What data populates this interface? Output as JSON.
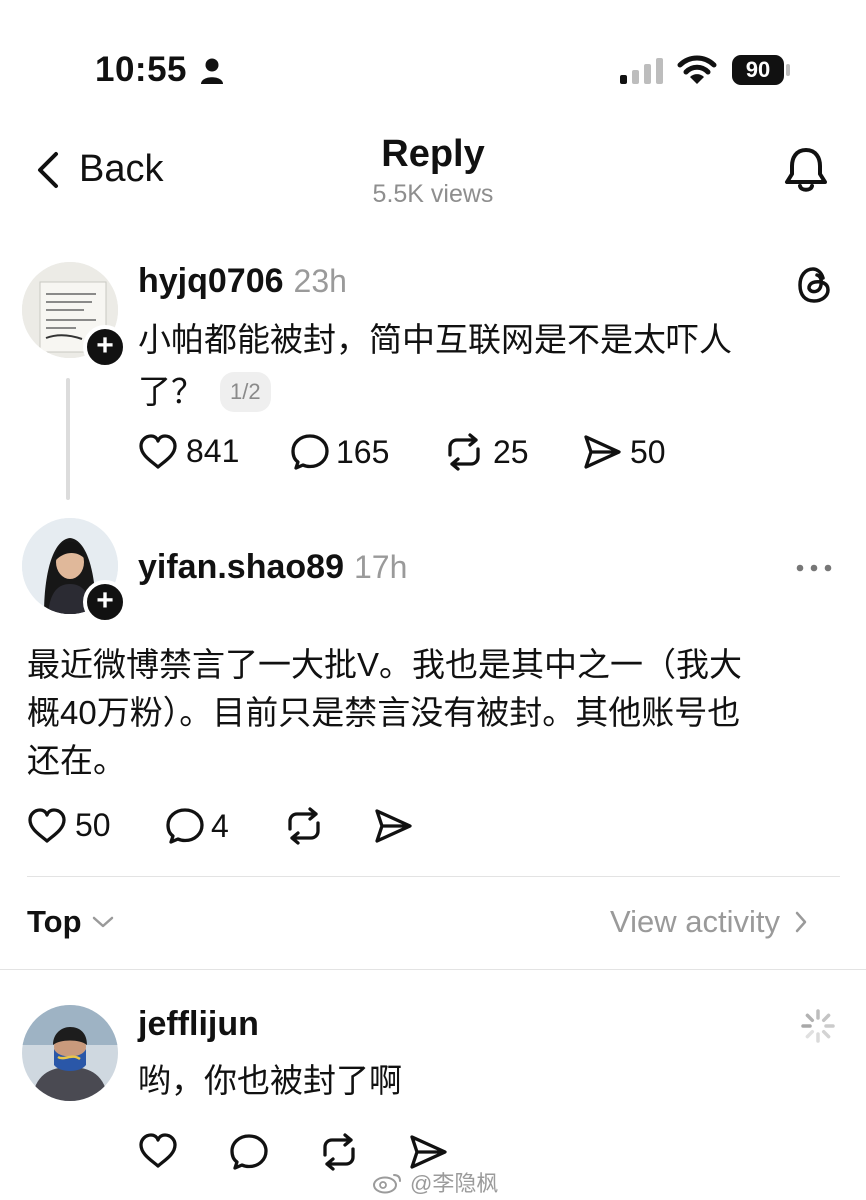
{
  "status_bar": {
    "time": "10:55",
    "battery": "90"
  },
  "header": {
    "back_label": "Back",
    "title": "Reply",
    "views": "5.5K views"
  },
  "posts": [
    {
      "username": "hyjq0706",
      "time_ago": "23h",
      "text_line1": "小帕都能被封，简中互联网是不是太吓人",
      "text_line2": "了？",
      "page_badge": "1/2",
      "likes": "841",
      "comments": "165",
      "reposts": "25",
      "shares": "50"
    },
    {
      "username": "yifan.shao89",
      "time_ago": "17h",
      "text_line1": "最近微博禁言了一大批V。我也是其中之一（我大",
      "text_line2": "概40万粉）。目前只是禁言没有被封。其他账号也",
      "text_line3": "还在。",
      "likes": "50",
      "comments": "4"
    }
  ],
  "sort": {
    "label": "Top",
    "view_activity": "View activity"
  },
  "replies": [
    {
      "username": "jefflijun",
      "text": "哟，你也被封了啊"
    }
  ],
  "watermark": "@李隐枫"
}
